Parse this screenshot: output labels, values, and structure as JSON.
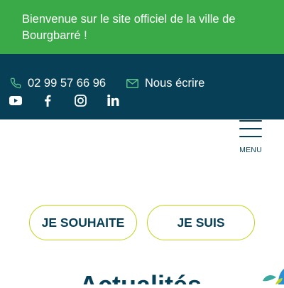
{
  "banner": {
    "text": "Bienvenue sur le site officiel de la ville de Bourgbarré !"
  },
  "contact": {
    "phone": {
      "icon": "phone-icon",
      "label": "02 99 57 66 96"
    },
    "mail": {
      "icon": "envelope-icon",
      "label": "Nous écrire"
    }
  },
  "social": [
    "youtube-icon",
    "facebook-icon",
    "instagram-icon",
    "linkedin-icon"
  ],
  "nav": {
    "menu_label": "MENU"
  },
  "cta": {
    "wish_label": "JE SOUHAITE",
    "am_label": "JE SUIS"
  },
  "news": {
    "title": "Actualités"
  },
  "colors": {
    "banner_green": "#3aa947",
    "topbar_navy": "#063f56",
    "accent_phone": "#5bbf8a",
    "pill_border": "#c2d41b"
  }
}
